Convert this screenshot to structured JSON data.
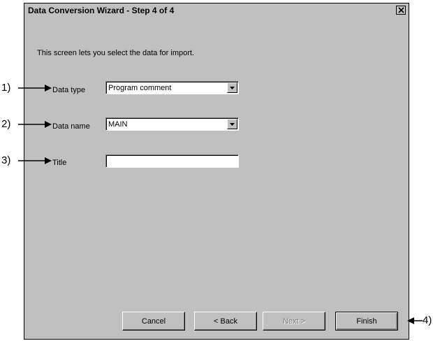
{
  "dialog": {
    "title": "Data Conversion Wizard - Step 4 of 4",
    "intro": "This screen lets you select the data for import."
  },
  "fields": {
    "data_type": {
      "label": "Data type",
      "value": "Program comment"
    },
    "data_name": {
      "label": "Data name",
      "value": "MAIN"
    },
    "title": {
      "label": "Title",
      "value": ""
    }
  },
  "buttons": {
    "cancel": "Cancel",
    "back": "< Back",
    "next": "Next >",
    "finish": "Finish"
  },
  "callouts": [
    "1)",
    "2)",
    "3)",
    "4)"
  ],
  "icons": {
    "close": "close-icon",
    "dropdown": "chevron-down-icon",
    "arrow": "arrow-right-icon"
  },
  "colors": {
    "face": "#c0c0c0",
    "shadow": "#808080",
    "field": "#ffffff"
  }
}
